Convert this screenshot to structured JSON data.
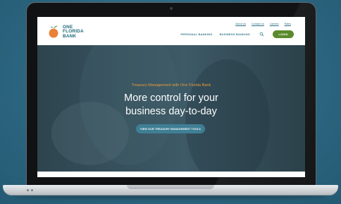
{
  "brand": {
    "line1": "ONE",
    "line2": "FLORIDA",
    "line3": "BANK",
    "colors": {
      "teal": "#1f6b79",
      "orange": "#e8823a",
      "green": "#5a8a2c"
    }
  },
  "header": {
    "top_links": [
      "About Us",
      "Contact Us",
      "Careers",
      "Rates"
    ],
    "nav": [
      "PERSONAL BANKING",
      "BUSINESS BANKING"
    ],
    "search_icon": "search-icon",
    "login_label": "LOGIN"
  },
  "hero": {
    "tagline": "Treasury Management with One Florida Bank",
    "headline_line1": "More control for your",
    "headline_line2": "business day-to-day",
    "cta_label": "VIEW OUR TREASURY MANAGEMENT TOOLS",
    "tagline_color": "#e89a3c"
  }
}
